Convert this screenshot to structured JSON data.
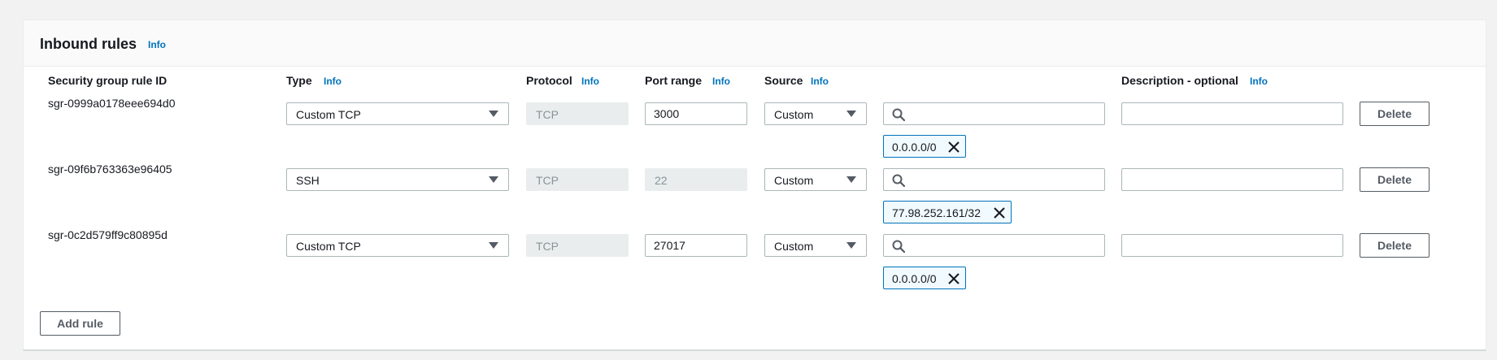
{
  "panel": {
    "title": "Inbound rules",
    "info": "Info"
  },
  "columns": {
    "rule_id": "Security group rule ID",
    "type": "Type",
    "protocol": "Protocol",
    "port_range": "Port range",
    "source": "Source",
    "description": "Description - optional",
    "info": "Info"
  },
  "rules": [
    {
      "id": "sgr-0999a0178eee694d0",
      "type": "Custom TCP",
      "protocol": "TCP",
      "port": "3000",
      "port_disabled": false,
      "source": "Custom",
      "search_value": "",
      "cidr": "0.0.0.0/0",
      "description": "",
      "delete_label": "Delete"
    },
    {
      "id": "sgr-09f6b763363e96405",
      "type": "SSH",
      "protocol": "TCP",
      "port": "22",
      "port_disabled": true,
      "source": "Custom",
      "search_value": "",
      "cidr": "77.98.252.161/32",
      "description": "",
      "delete_label": "Delete"
    },
    {
      "id": "sgr-0c2d579ff9c80895d",
      "type": "Custom TCP",
      "protocol": "TCP",
      "port": "27017",
      "port_disabled": false,
      "source": "Custom",
      "search_value": "",
      "cidr": "0.0.0.0/0",
      "description": "",
      "delete_label": "Delete"
    }
  ],
  "add_rule_label": "Add rule",
  "icons": {
    "search": "search-icon",
    "dropdown": "caret-down-icon",
    "remove": "close-icon"
  },
  "colors": {
    "link": "#0073bb",
    "token_border": "#0073bb",
    "token_bg": "#f1faff",
    "disabled_bg": "#eaeded",
    "button_border": "#545b64"
  }
}
